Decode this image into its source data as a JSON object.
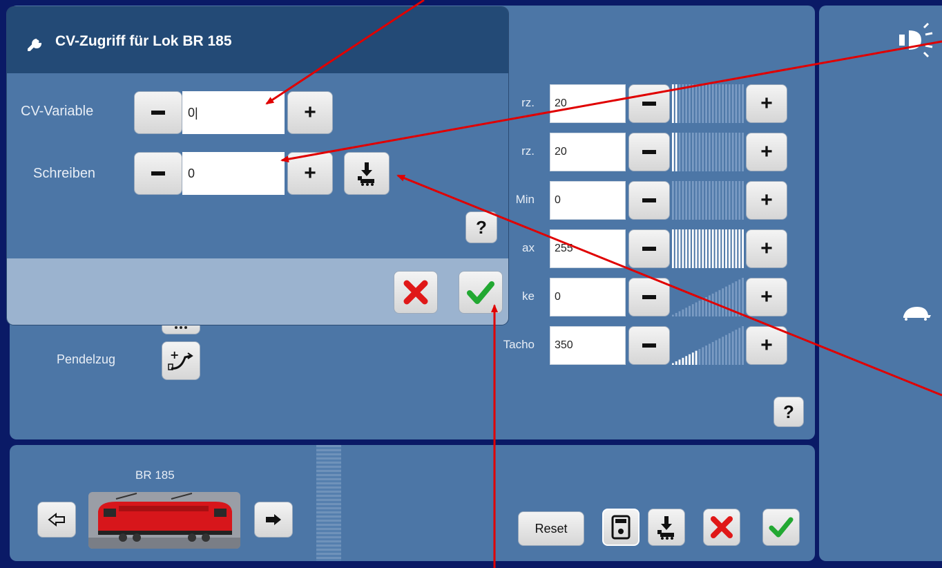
{
  "dialog": {
    "title": "CV-Zugriff für Lok BR 185",
    "cv_variable_label": "CV-Variable",
    "cv_variable_value": "0|",
    "schreiben_label": "Schreiben",
    "schreiben_value": "0",
    "help_label": "?",
    "icons": {
      "title": "wrench-icon",
      "write": "write-to-loco-icon",
      "cancel": "red-x-icon",
      "confirm": "green-check-icon"
    }
  },
  "settings": {
    "rows": [
      {
        "label": "rz.",
        "value": "20"
      },
      {
        "label": "rz.",
        "value": "20"
      },
      {
        "label": "Min",
        "value": "0"
      },
      {
        "label": "ax",
        "value": "255"
      },
      {
        "label": "ke",
        "value": "0"
      },
      {
        "label": "Tacho",
        "value": "350"
      }
    ],
    "levels": [
      0.08,
      0.08,
      0.0,
      1.0,
      0.0,
      0.35
    ],
    "help_label": "?"
  },
  "left": {
    "pendelzug_label": "Pendelzug"
  },
  "locomotive": {
    "name": "BR 185"
  },
  "footer": {
    "reset_label": "Reset"
  },
  "colors": {
    "panel": "#4c76a6",
    "dialog_header": "#234a76",
    "background": "#0a1a66",
    "annotation_arrow": "#e00000",
    "cancel": "#e01818",
    "confirm": "#22a832"
  }
}
